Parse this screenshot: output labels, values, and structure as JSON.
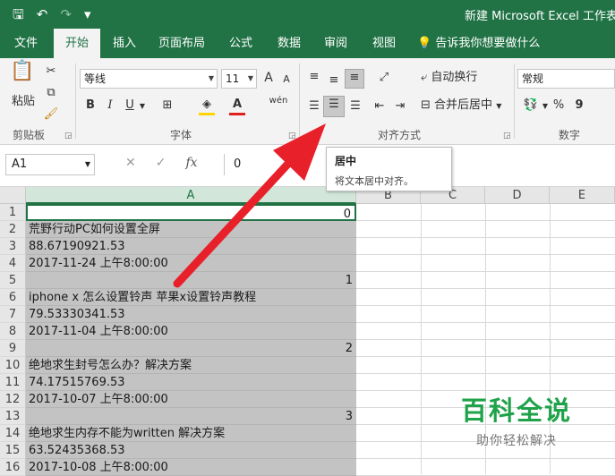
{
  "window": {
    "quick_access": {
      "save_icon": "save-icon",
      "undo_icon": "undo-icon",
      "redo_icon": "redo-icon",
      "customize": "▾"
    },
    "title": "新建 Microsoft Excel 工作表.x"
  },
  "tabs": [
    {
      "label": "文件",
      "active": false
    },
    {
      "label": "开始",
      "active": true
    },
    {
      "label": "插入",
      "active": false
    },
    {
      "label": "页面布局",
      "active": false
    },
    {
      "label": "公式",
      "active": false
    },
    {
      "label": "数据",
      "active": false
    },
    {
      "label": "审阅",
      "active": false
    },
    {
      "label": "视图",
      "active": false
    }
  ],
  "tell_me": "告诉我你想要做什么",
  "ribbon": {
    "clipboard": {
      "paste": "粘贴",
      "label": "剪贴板"
    },
    "font": {
      "name": "等线",
      "size": "11",
      "grow": "A",
      "shrink": "A",
      "bold": "B",
      "italic": "I",
      "underline": "U",
      "phonetic": "wén",
      "label": "字体"
    },
    "alignment": {
      "wrap": "自动换行",
      "merge": "合并后居中",
      "label": "对齐方式"
    },
    "number": {
      "format": "常规",
      "percent": "%",
      "comma": "9",
      "label": "数字"
    }
  },
  "formula_bar": {
    "name_box": "A1",
    "fx": "fx",
    "value": "0"
  },
  "tooltip": {
    "title": "居中",
    "description": "将文本居中对齐。"
  },
  "columns": [
    "A",
    "B",
    "C",
    "D",
    "E"
  ],
  "rows": [
    {
      "n": "1",
      "a": "0",
      "num": true
    },
    {
      "n": "2",
      "a": "荒野行动PC如何设置全屏",
      "num": false
    },
    {
      "n": "3",
      "a": "88.67190921.53",
      "num": false
    },
    {
      "n": "4",
      "a": "2017-11-24 上午8:00:00",
      "num": false
    },
    {
      "n": "5",
      "a": "1",
      "num": true
    },
    {
      "n": "6",
      "a": "iphone x 怎么设置铃声 苹果x设置铃声教程",
      "num": false
    },
    {
      "n": "7",
      "a": "79.53330341.53",
      "num": false
    },
    {
      "n": "8",
      "a": "2017-11-04 上午8:00:00",
      "num": false
    },
    {
      "n": "9",
      "a": "2",
      "num": true
    },
    {
      "n": "10",
      "a": "绝地求生封号怎么办？解决方案",
      "num": false
    },
    {
      "n": "11",
      "a": "74.17515769.53",
      "num": false
    },
    {
      "n": "12",
      "a": "2017-10-07 上午8:00:00",
      "num": false
    },
    {
      "n": "13",
      "a": "3",
      "num": true
    },
    {
      "n": "14",
      "a": "绝地求生内存不能为written 解决方案",
      "num": false
    },
    {
      "n": "15",
      "a": "63.52435368.53",
      "num": false
    },
    {
      "n": "16",
      "a": "2017-10-08 上午8:00:00",
      "num": false
    }
  ],
  "watermark": {
    "line1": "百科全说",
    "line2": "助你轻松解决"
  },
  "colors": {
    "excel_green": "#217346",
    "arrow_red": "#e8202a",
    "selection_gray": "#c3c3c3"
  }
}
